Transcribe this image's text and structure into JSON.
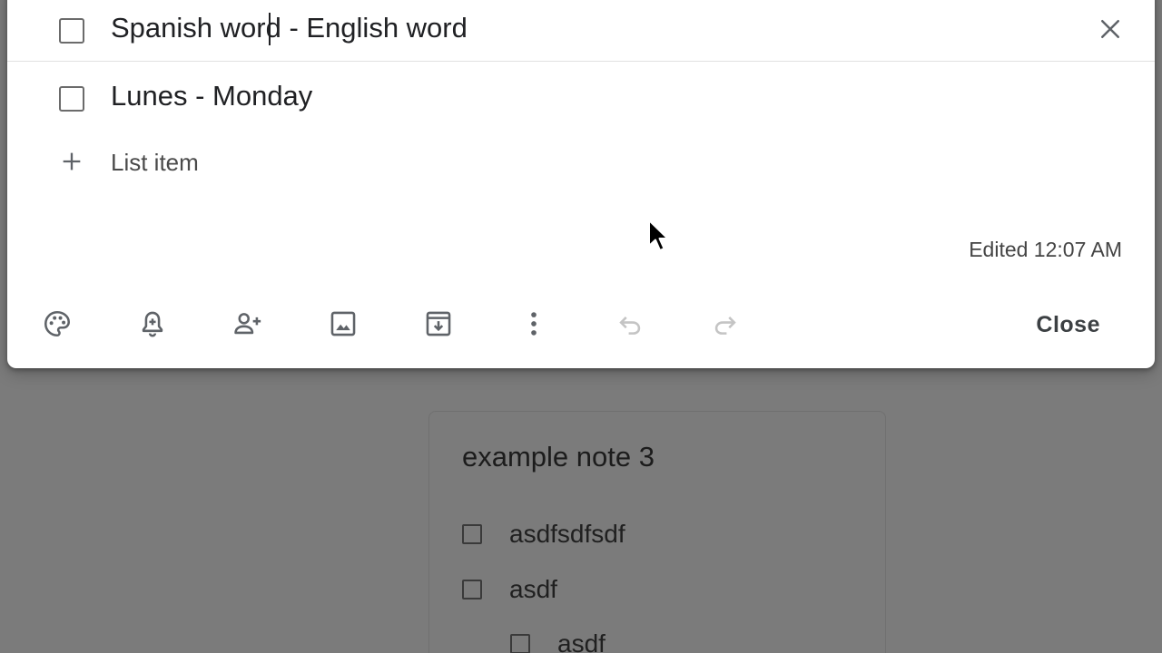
{
  "editor": {
    "items": [
      {
        "text": "Spanish word - English word",
        "checked": false
      },
      {
        "text": "Lunes - Monday",
        "checked": false
      }
    ],
    "add_item_placeholder": "List item",
    "edited_label": "Edited 12:07 AM",
    "close_label": "Close",
    "toolbar_icons": [
      "palette-icon",
      "reminder-bell-icon",
      "collaborator-icon",
      "add-image-icon",
      "archive-icon",
      "more-vert-icon",
      "undo-icon",
      "redo-icon"
    ],
    "undo_enabled": false,
    "redo_enabled": false
  },
  "background_note": {
    "title": "example note 3",
    "items": [
      {
        "text": "asdfsdfsdf",
        "checked": false
      },
      {
        "text": "asdf",
        "checked": false
      },
      {
        "text": "asdf",
        "checked": false,
        "indented": true
      }
    ]
  },
  "colors": {
    "overlay": "#7b7b7b",
    "modal_background": "#ffffff",
    "text_primary": "#202124",
    "icon_disabled": "#c4c4c4"
  }
}
